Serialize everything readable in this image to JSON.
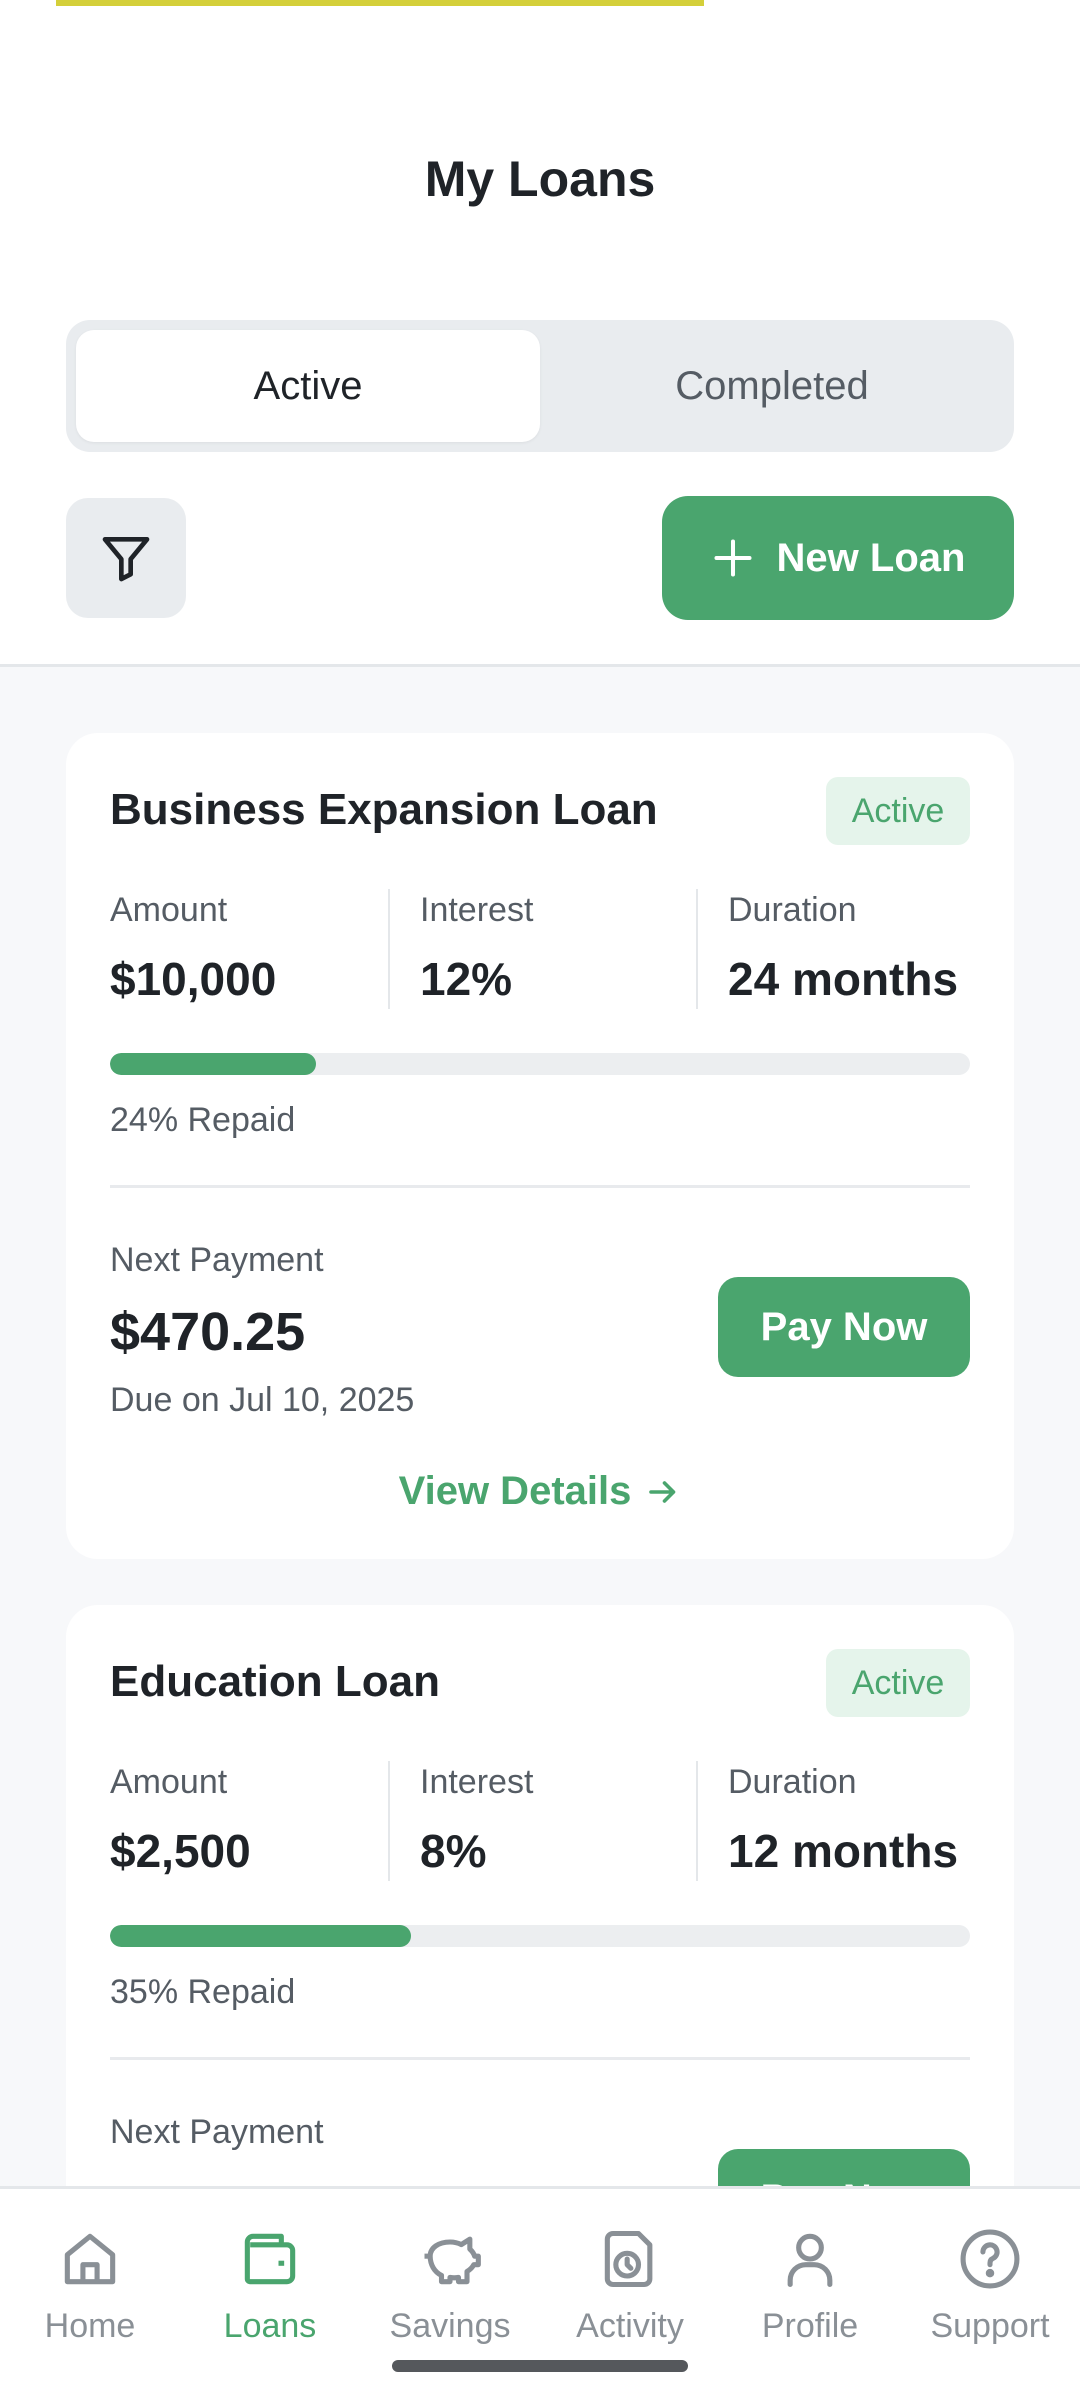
{
  "header": {
    "title": "My Loans",
    "tabs": [
      {
        "label": "Active",
        "selected": true
      },
      {
        "label": "Completed",
        "selected": false
      }
    ],
    "new_loan_label": "New Loan"
  },
  "colors": {
    "accent": "#4aa56e",
    "badge_bg": "#e5f4eb",
    "top_accent": "#d4cf3a"
  },
  "loans": [
    {
      "name": "Business Expansion Loan",
      "status": "Active",
      "amount_label": "Amount",
      "amount": "$10,000",
      "interest_label": "Interest",
      "interest": "12%",
      "duration_label": "Duration",
      "duration": "24 months",
      "repaid_fraction": 0.24,
      "repaid_text": "24% Repaid",
      "next_payment_label": "Next Payment",
      "next_payment_amount": "$470.25",
      "due_text": "Due on Jul 10, 2025",
      "pay_label": "Pay Now",
      "view_details_label": "View Details"
    },
    {
      "name": "Education Loan",
      "status": "Active",
      "amount_label": "Amount",
      "amount": "$2,500",
      "interest_label": "Interest",
      "interest": "8%",
      "duration_label": "Duration",
      "duration": "12 months",
      "repaid_fraction": 0.35,
      "repaid_text": "35% Repaid",
      "next_payment_label": "Next Payment",
      "pay_label": "Pay Now"
    }
  ],
  "nav": {
    "items": [
      {
        "label": "Home",
        "icon": "home-icon",
        "active": false
      },
      {
        "label": "Loans",
        "icon": "wallet-icon",
        "active": true
      },
      {
        "label": "Savings",
        "icon": "piggy-bank-icon",
        "active": false
      },
      {
        "label": "Activity",
        "icon": "activity-icon",
        "active": false
      },
      {
        "label": "Profile",
        "icon": "user-icon",
        "active": false
      },
      {
        "label": "Support",
        "icon": "help-icon",
        "active": false
      }
    ]
  }
}
